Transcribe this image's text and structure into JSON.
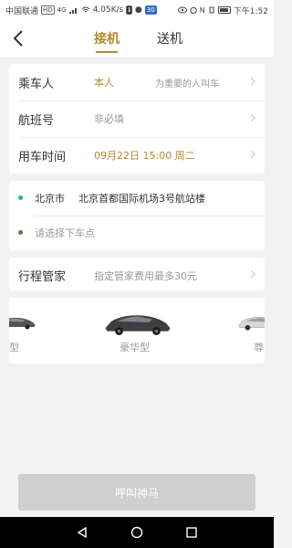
{
  "status_bar": {
    "carrier": "中国联通",
    "hd_badge": "HD",
    "network": "4G",
    "speed": "4.05K/s",
    "notif_badge": "30",
    "time": "下午1:52"
  },
  "header": {
    "tabs": [
      {
        "label": "接机",
        "active": true
      },
      {
        "label": "送机",
        "active": false
      }
    ],
    "accent_color": "#b5892c"
  },
  "form": {
    "passenger": {
      "label": "乘车人",
      "value": "本人",
      "extra": "为重要的人叫车"
    },
    "flight": {
      "label": "航班号",
      "placeholder": "非必填"
    },
    "time": {
      "label": "用车时间",
      "value": "09月22日 15:00 周二"
    }
  },
  "location": {
    "pickup_city": "北京市",
    "pickup_address": "北京首都国际机场3号航站楼",
    "dropoff_placeholder": "请选择下车点"
  },
  "steward": {
    "label": "行程管家",
    "value": "指定管家费用最多30元"
  },
  "car_types": [
    {
      "label": "型"
    },
    {
      "label": "豪华型"
    },
    {
      "label": "尊"
    }
  ],
  "call_button": {
    "label": "呼叫神马"
  }
}
